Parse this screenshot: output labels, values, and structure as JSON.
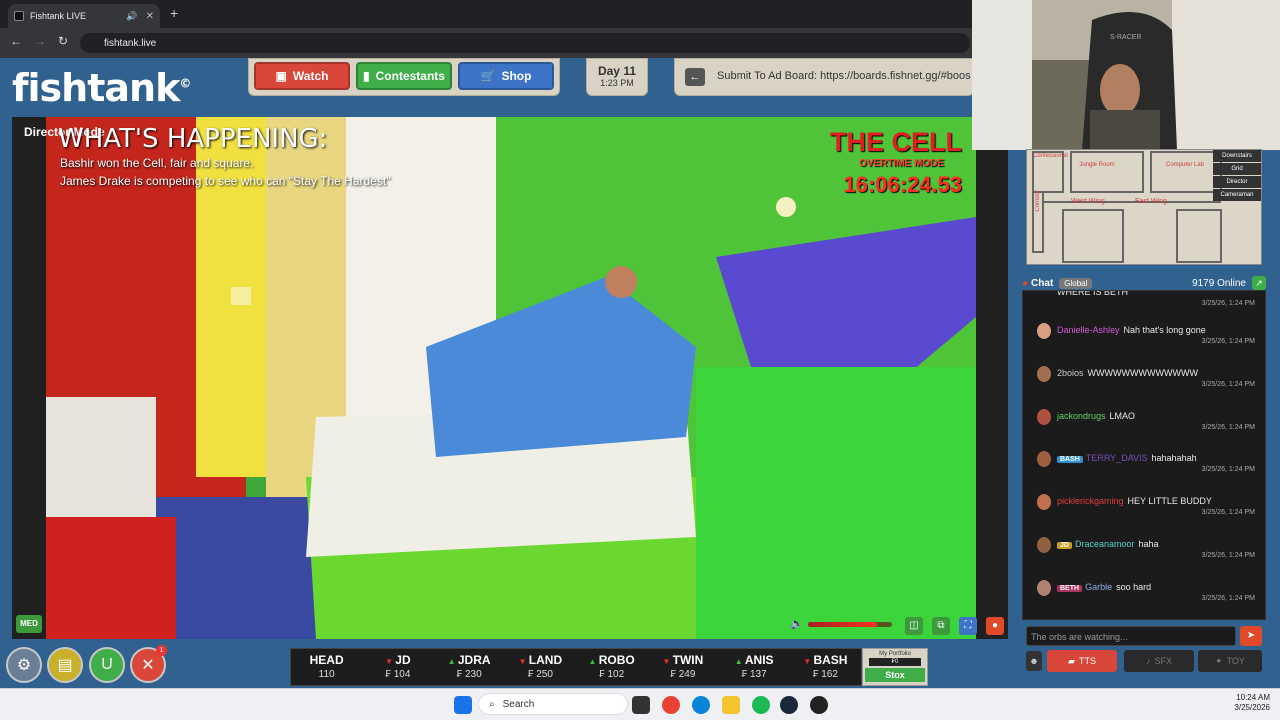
{
  "browser": {
    "tab_title": "Fishtank LIVE",
    "url": "fishtank.live"
  },
  "site": {
    "logo": "fishtank",
    "logo_mark": "©",
    "nav": [
      {
        "label": "Watch",
        "color": "#d9463a"
      },
      {
        "label": "Contestants",
        "color": "#3fae48"
      },
      {
        "label": "Shop",
        "color": "#3e74c8"
      }
    ],
    "day": {
      "label": "Day 11",
      "time": "1:23 PM"
    },
    "ad_board": "Submit To Ad Board: https://boards.fishnet.gg/#boos"
  },
  "video": {
    "director_mode": "Director Mode",
    "heading": "WHAT'S HAPPENING:",
    "line1": "Bashir won the Cell, fair and square.",
    "line2": "James Drake is competing to see who can \"Stay The Hardest\"",
    "cell_title": "THE CELL",
    "cell_mode": "OVERTIME MODE",
    "timer": "16:06:24.53",
    "quality": "MED",
    "volume_fraction": 0.82
  },
  "ticker": [
    {
      "name": "HEAD",
      "dir": "",
      "price": "110"
    },
    {
      "name": "JD",
      "dir": "down",
      "price": "104"
    },
    {
      "name": "JDRA",
      "dir": "up",
      "price": "230"
    },
    {
      "name": "LAND",
      "dir": "down",
      "price": "250"
    },
    {
      "name": "ROBO",
      "dir": "up",
      "price": "102"
    },
    {
      "name": "TWIN",
      "dir": "down",
      "price": "249"
    },
    {
      "name": "ANIS",
      "dir": "up",
      "price": "137"
    },
    {
      "name": "BASH",
      "dir": "down",
      "price": "162"
    }
  ],
  "ticker_currency": "₣",
  "portfolio": {
    "label": "My Portfolio",
    "value": "₣0",
    "button": "Stox"
  },
  "notification_count": "1",
  "map": {
    "rooms": [
      "Confessional",
      "Jungle Room",
      "Computer Lab",
      "Corridor",
      "West Wing",
      "East Wing"
    ],
    "buttons": [
      "Downstairs",
      "Grid",
      "Director",
      "Cameraman"
    ]
  },
  "chat": {
    "title": "Chat",
    "scope": "Global",
    "online": "9179 Online",
    "messages": [
      {
        "user": "",
        "user_color": "#fff",
        "tag": "",
        "tag_color": "",
        "text": "WHERE IS BETH",
        "time": "3/25/26, 1:24 PM"
      },
      {
        "user": "Danielle-Ashley",
        "user_color": "#d35ad8",
        "tag": "",
        "tag_color": "",
        "text": "Nah that's long gone",
        "time": "3/25/26, 1:24 PM"
      },
      {
        "user": "2boios",
        "user_color": "#c8c8c8",
        "tag": "",
        "tag_color": "",
        "text": "WWWWWWWWWWWWW",
        "time": "3/25/26, 1:24 PM"
      },
      {
        "user": "jackondrugs",
        "user_color": "#5fd35f",
        "tag": "",
        "tag_color": "",
        "text": "LMAO",
        "time": "3/25/26, 1:24 PM"
      },
      {
        "user": "TERRY_DAVIS",
        "user_color": "#7a4fb8",
        "tag": "BASH",
        "tag_color": "#2f8fd0",
        "text": "hahahahah",
        "time": "3/25/26, 1:24 PM"
      },
      {
        "user": "picklerickgaming",
        "user_color": "#e03a3a",
        "tag": "",
        "tag_color": "",
        "text": "HEY LITTLE BUDDY",
        "time": "3/25/26, 1:24 PM"
      },
      {
        "user": "Draceanamoor",
        "user_color": "#4fd3c8",
        "tag": "JD",
        "tag_color": "#c8a020",
        "text": "haha",
        "time": "3/25/26, 1:24 PM"
      },
      {
        "user": "Garble",
        "user_color": "#8fb3e8",
        "tag": "BETH",
        "tag_color": "#b03060",
        "text": "soo hard",
        "time": "3/25/26, 1:24 PM"
      }
    ],
    "input_placeholder": "The orbs are watching...",
    "buttons": [
      "TTS",
      "SFX",
      "TOY"
    ]
  },
  "taskbar": {
    "search": "Search",
    "time": "10:24 AM",
    "date": "3/25/2026"
  },
  "camera_label": "S-RACER"
}
